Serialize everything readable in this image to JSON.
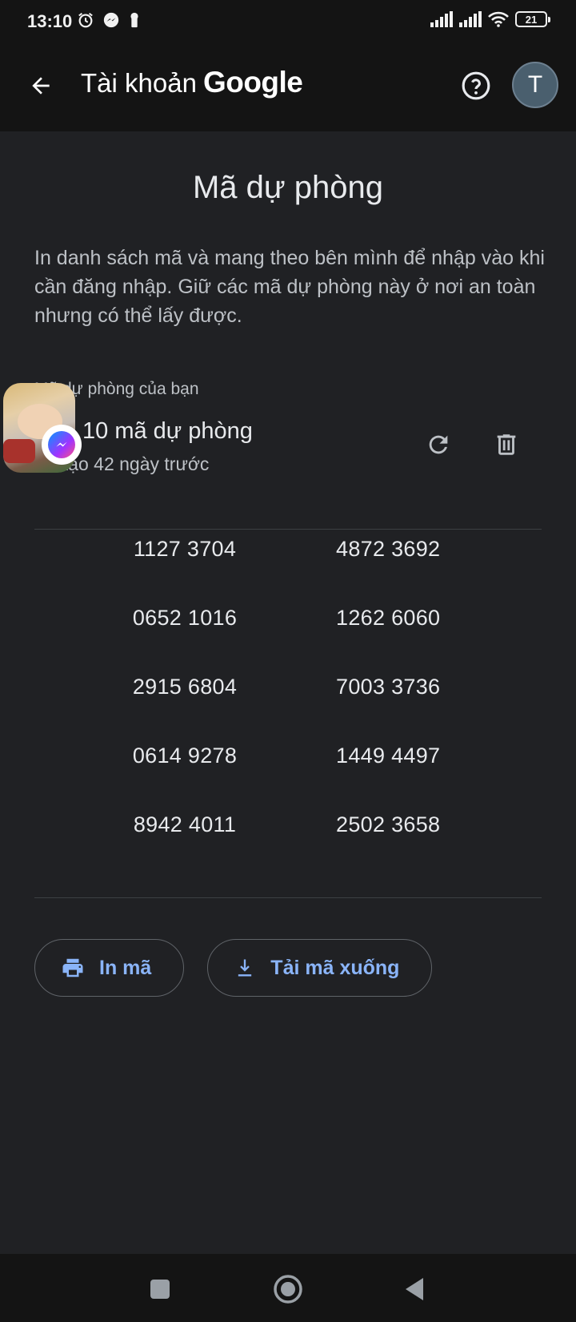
{
  "status_bar": {
    "time": "13:10",
    "battery": "21"
  },
  "app_bar": {
    "title_prefix": "Tài khoản",
    "title_brand": "Google",
    "avatar_letter": "T"
  },
  "page": {
    "title": "Mã dự phòng",
    "description": "In danh sách mã và mang theo bên mình để nhập vào khi cần đăng nhập. Giữ các mã dự phòng này ở nơi an toàn nhưng có thể lấy được.",
    "section_label": "Mã dự phòng của bạn",
    "codes_count": "10 mã dự phòng",
    "codes_created": "Đã tạo 42 ngày trước"
  },
  "codes": [
    [
      "1127 3704",
      "4872 3692"
    ],
    [
      "0652 1016",
      "1262 6060"
    ],
    [
      "2915 6804",
      "7003 3736"
    ],
    [
      "0614 9278",
      "1449 4497"
    ],
    [
      "8942 4011",
      "2502 3658"
    ]
  ],
  "actions": {
    "print_label": "In mã",
    "download_label": "Tải mã xuống"
  },
  "icons": {
    "back": "arrow-left-icon",
    "help": "help-circle-icon",
    "refresh": "refresh-icon",
    "delete": "trash-icon",
    "print": "printer-icon",
    "download": "download-icon",
    "messenger": "messenger-icon"
  },
  "colors": {
    "background": "#202124",
    "bar": "#141414",
    "accent": "#8ab4f8",
    "text": "#e8eaed",
    "secondary_text": "#bdc1c6"
  }
}
